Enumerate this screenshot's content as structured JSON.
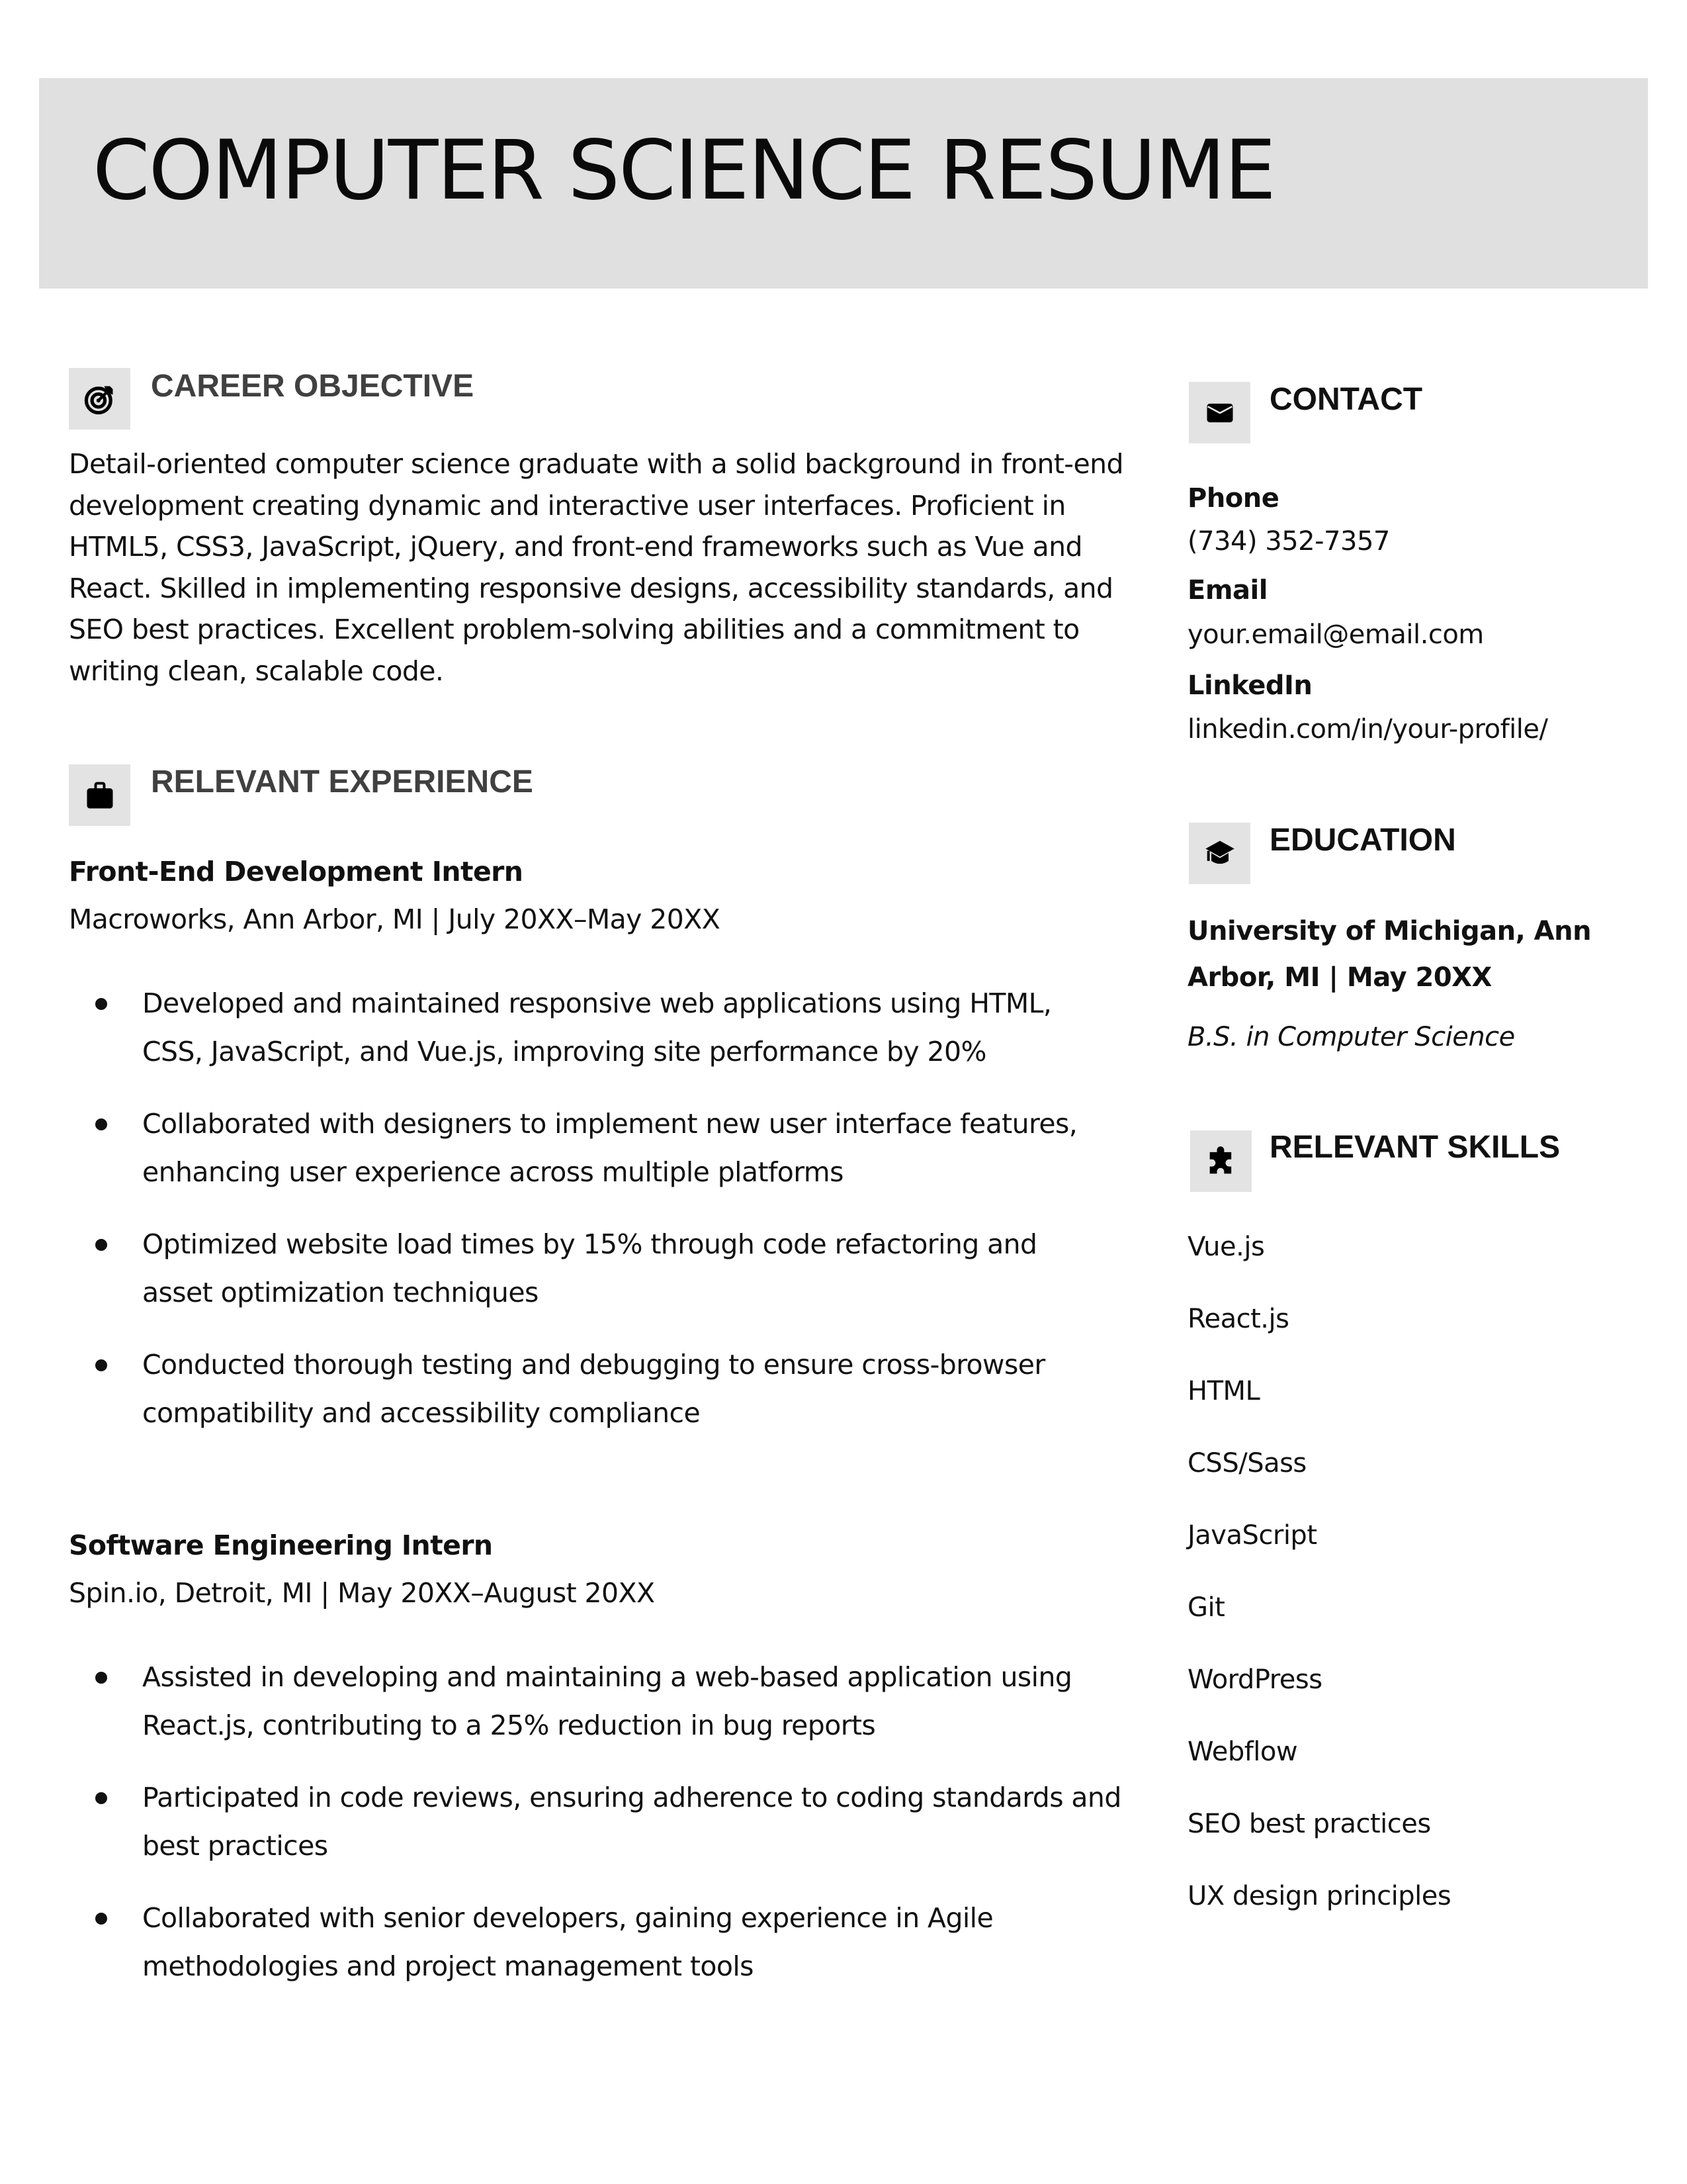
{
  "header": {
    "title": "COMPUTER SCIENCE RESUME",
    "band_color": "#e0e0e0"
  },
  "career_objective": {
    "icon": "target-icon",
    "heading": "CAREER OBJECTIVE",
    "text": "Detail-oriented computer science graduate with a solid background in front-end development creating dynamic and interactive user interfaces. Proficient in HTML5, CSS3, JavaScript, jQuery, and front-end frameworks such as Vue and React. Skilled in implementing responsive designs, accessibility standards, and SEO best practices. Excellent problem-solving abilities and a commitment to writing clean, scalable code."
  },
  "experience": {
    "icon": "briefcase-icon",
    "heading": "RELEVANT EXPERIENCE",
    "jobs": [
      {
        "title": "Front-End Development Intern",
        "meta": "Macroworks, Ann Arbor, MI | July 20XX–May 20XX",
        "bullets": [
          "Developed and maintained responsive web applications using HTML, CSS, JavaScript, and Vue.js, improving site performance by 20%",
          "Collaborated with designers to implement new user interface features, enhancing user experience across multiple platforms",
          "Optimized website load times by 15% through code refactoring and asset optimization techniques",
          "Conducted thorough testing and debugging to ensure cross-browser compatibility and accessibility compliance"
        ]
      },
      {
        "title": "Software Engineering Intern",
        "meta": "Spin.io, Detroit, MI | May 20XX–August 20XX",
        "bullets": [
          "Assisted in developing and maintaining a web-based application using React.js, contributing to a 25% reduction in bug reports",
          "Participated in code reviews, ensuring adherence to coding standards and best practices",
          "Collaborated with senior developers, gaining experience in Agile methodologies and project management tools"
        ]
      }
    ]
  },
  "contact": {
    "icon": "envelope-icon",
    "heading": "CONTACT",
    "phone_label": "Phone",
    "phone": "(734) 352-7357",
    "email_label": "Email",
    "email": "your.email@email.com",
    "linkedin_label": "LinkedIn",
    "linkedin": "linkedin.com/in/your-profile/"
  },
  "education": {
    "icon": "graduation-cap-icon",
    "heading": "EDUCATION",
    "school": "University of Michigan, Ann Arbor, MI | May 20XX",
    "degree": "B.S. in Computer Science"
  },
  "skills": {
    "icon": "puzzle-piece-icon",
    "heading": "RELEVANT SKILLS",
    "items": [
      "Vue.js",
      "React.js",
      "HTML",
      "CSS/Sass",
      "JavaScript",
      "Git",
      "WordPress",
      "Webflow",
      "SEO best practices",
      "UX design principles"
    ]
  }
}
